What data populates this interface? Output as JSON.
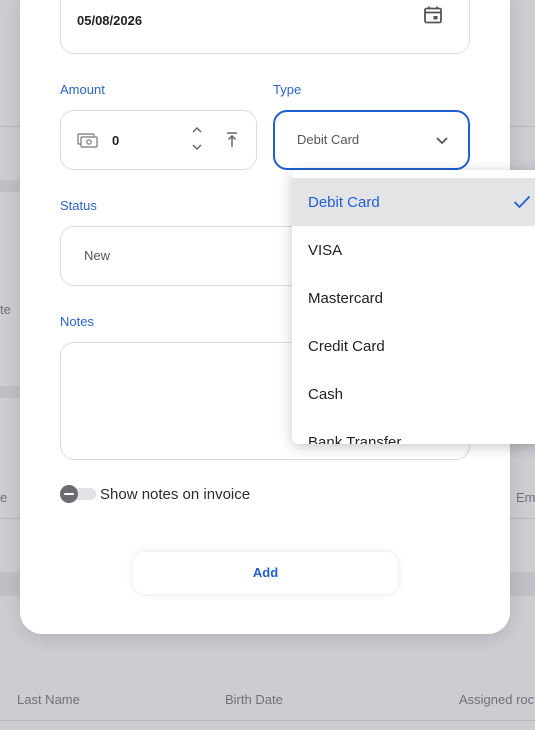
{
  "background": {
    "fragments": {
      "left_row1": "te",
      "left_row2": "e",
      "right_row2": "Em"
    },
    "table_headers": [
      "Last Name",
      "Birth Date",
      "Assigned roc"
    ]
  },
  "form": {
    "date": {
      "value": "05/08/2026",
      "icon": "calendar-icon"
    },
    "amount": {
      "label": "Amount",
      "value": "0",
      "icon": "money-icon"
    },
    "type": {
      "label": "Type",
      "value": "Debit Card"
    },
    "status": {
      "label": "Status",
      "value": "New"
    },
    "notes": {
      "label": "Notes",
      "value": ""
    },
    "show_notes": {
      "label": "Show notes on invoice",
      "checked": false
    },
    "add_label": "Add"
  },
  "dropdown": {
    "options": [
      "Debit Card",
      "VISA",
      "Mastercard",
      "Credit Card",
      "Cash",
      "Bank Transfer"
    ],
    "selected": "Debit Card"
  },
  "colors": {
    "accent": "#1f5fd1",
    "label": "#2a62c9",
    "selected_bg": "#e4e4e6"
  }
}
